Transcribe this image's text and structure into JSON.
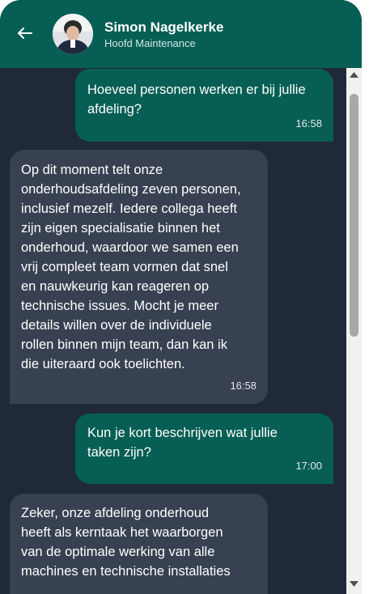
{
  "header": {
    "contact_name": "Simon Nagelkerke",
    "contact_role": "Hoofd Maintenance",
    "back_icon": "arrow-left-icon",
    "background_color": "#075e54"
  },
  "messages": [
    {
      "direction": "outgoing",
      "text": "Hoeveel personen werken er bij jullie\nafdeling?",
      "time": "16:58"
    },
    {
      "direction": "incoming",
      "text": "Op dit moment telt onze\nonderhoudsafdeling zeven personen,\ninclusief mezelf. Iedere collega heeft\nzijn eigen specialisatie binnen het\nonderhoud, waardoor we samen een\nvrij compleet team vormen dat snel\nen nauwkeurig kan reageren op\ntechnische issues. Mocht je meer\ndetails willen over de individuele\nrollen binnen mijn team, dan kan ik\ndie uiteraard ook toelichten.",
      "time": "16:58"
    },
    {
      "direction": "outgoing",
      "text": "Kun je kort beschrijven wat jullie\ntaken zijn?",
      "time": "17:00"
    },
    {
      "direction": "incoming",
      "text": "Zeker, onze afdeling onderhoud\nheeft als kerntaak het waarborgen\nvan de optimale werking van alle\nmachines en technische installaties",
      "time": ""
    }
  ],
  "colors": {
    "chat_background": "#1f2937",
    "outgoing_bubble": "#075e54",
    "incoming_bubble": "#374151"
  }
}
